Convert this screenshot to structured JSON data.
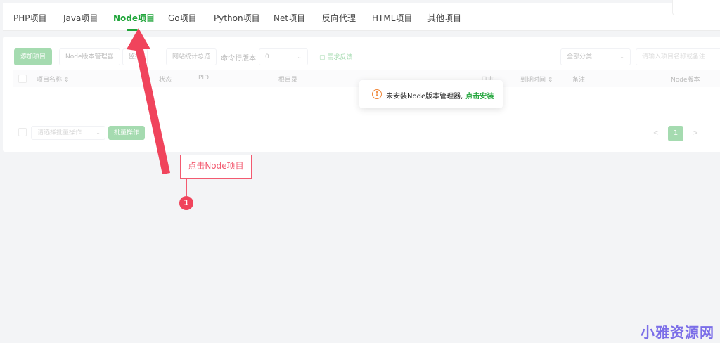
{
  "tabs": [
    {
      "label": "PHP项目"
    },
    {
      "label": "Java项目"
    },
    {
      "label": "Node项目",
      "active": true
    },
    {
      "label": "Go项目"
    },
    {
      "label": "Python项目"
    },
    {
      "label": "Net项目"
    },
    {
      "label": "反向代理"
    },
    {
      "label": "HTML项目"
    },
    {
      "label": "其他项目"
    }
  ],
  "toolbar": {
    "add_project": "添加项目",
    "node_manager": "Node版本管理器",
    "monitor": "监控",
    "site_stats": "网站统计总览",
    "cmd_version_label": "命令行版本",
    "cmd_version_value": "0",
    "feedback": "需求反馈",
    "category": "全部分类",
    "search_placeholder": "请输入项目名称或备注"
  },
  "table": {
    "headers": [
      "项目名称",
      "状态",
      "PID",
      "根目录",
      "日志",
      "到期时间",
      "备注",
      "Node版本"
    ]
  },
  "footer": {
    "batch_select": "请选择批量操作",
    "batch_button": "批量操作",
    "page_prev": "<",
    "page_current": "1",
    "page_next": ">"
  },
  "toast": {
    "message": "未安装Node版本管理器,",
    "link": "点击安装",
    "icon": "warning-icon"
  },
  "annotation": {
    "callout": "点击Node项目",
    "step": "1"
  },
  "watermark": "小雅资源网",
  "colors": {
    "accent": "#20a53a",
    "annotation": "#f35a70",
    "warning": "#f0883a"
  }
}
